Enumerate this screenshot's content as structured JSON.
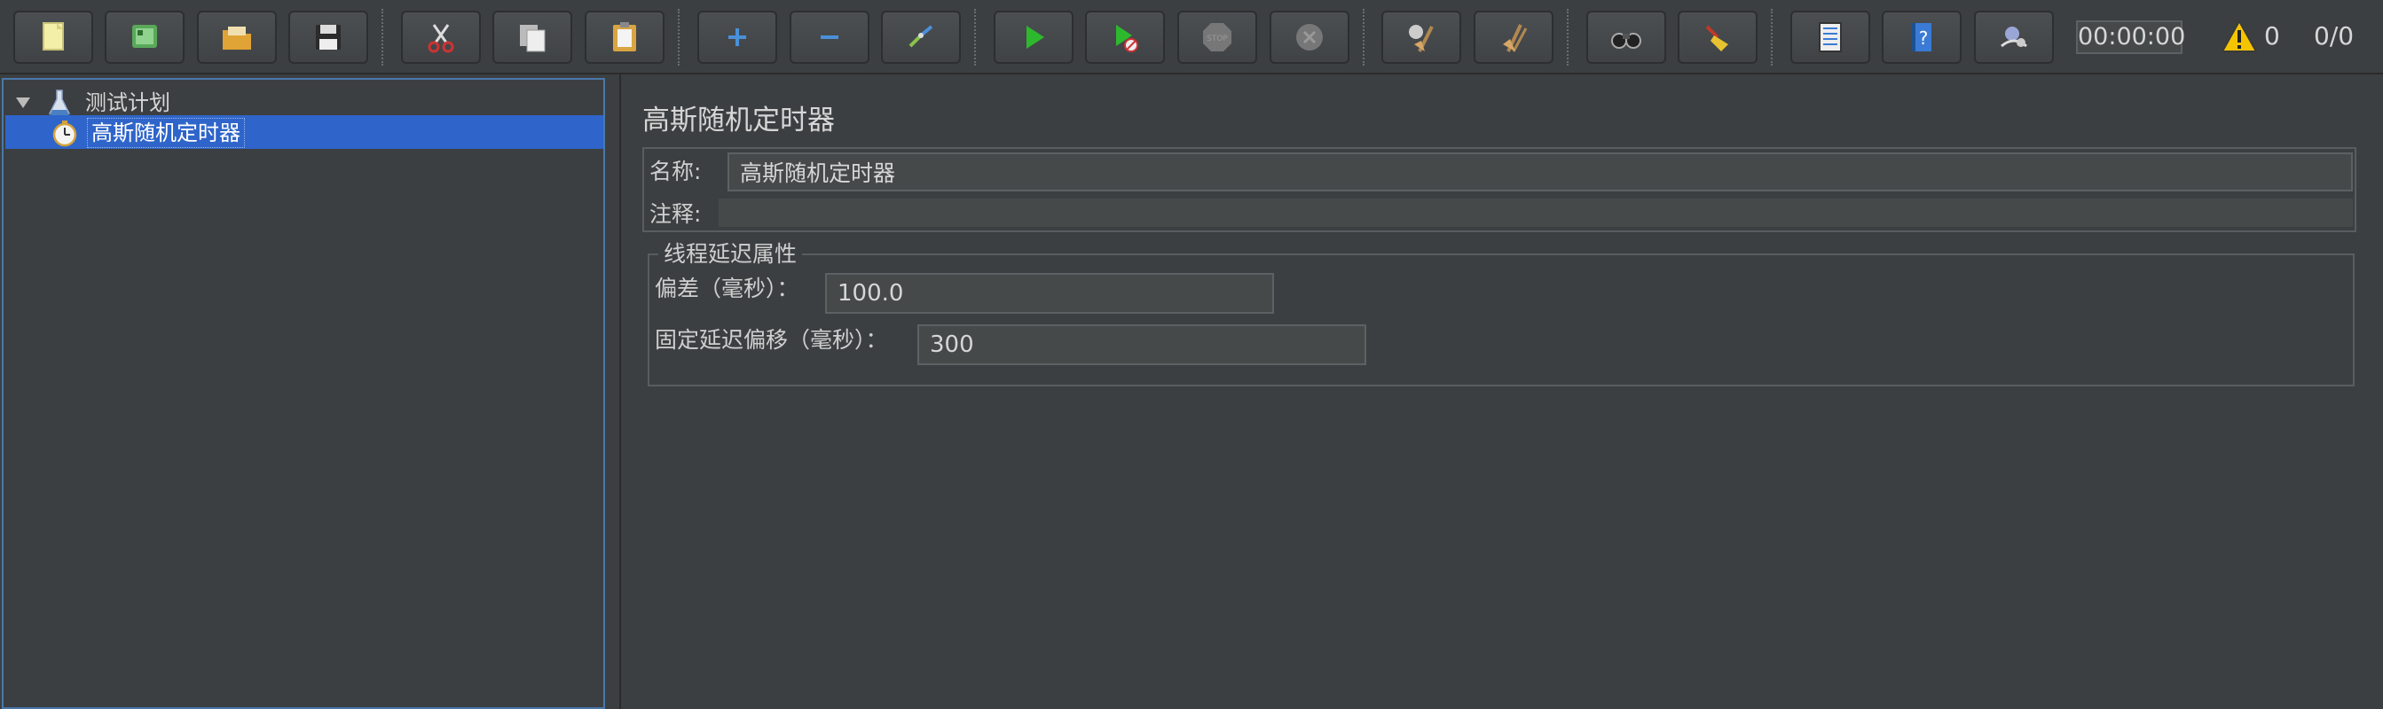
{
  "toolbar": {
    "buttons": [
      {
        "name": "new-icon",
        "color": "#f2eda0"
      },
      {
        "name": "templates-icon",
        "color": "#5aa85a"
      },
      {
        "name": "open-icon",
        "color": "#e0a336"
      },
      {
        "name": "save-icon",
        "color": "#444444"
      },
      {
        "name": "cut-icon",
        "color": "#cc3333"
      },
      {
        "name": "copy-icon",
        "color": "#dddddd"
      },
      {
        "name": "paste-icon",
        "color": "#d9a441"
      },
      {
        "name": "expand-icon",
        "color": "#4a90d9"
      },
      {
        "name": "collapse-icon",
        "color": "#4a90d9"
      },
      {
        "name": "toggle-icon",
        "color": "#8bc34a"
      },
      {
        "name": "start-icon",
        "color": "#2eb82e"
      },
      {
        "name": "start-no-pauses-icon",
        "color": "#2eb82e"
      },
      {
        "name": "stop-icon",
        "color": "#777777"
      },
      {
        "name": "shutdown-icon",
        "color": "#777777"
      },
      {
        "name": "clear-icon",
        "color": "#b08850"
      },
      {
        "name": "clear-all-icon",
        "color": "#b08850"
      },
      {
        "name": "search-icon",
        "color": "#222222"
      },
      {
        "name": "reset-search-icon",
        "color": "#e8c230"
      },
      {
        "name": "function-helper-icon",
        "color": "#cccccc"
      },
      {
        "name": "help-icon",
        "color": "#3a7bd5"
      },
      {
        "name": "remote-icon",
        "color": "#9aa6d6"
      }
    ],
    "timer": "00:00:00",
    "warning_count": "0",
    "thread_count": "0/0",
    "warning_color": "#f5c400"
  },
  "tree": {
    "root": {
      "label": "测试计划",
      "icon": "flask-icon"
    },
    "selected": {
      "label": "高斯随机定时器",
      "icon": "timer-icon"
    },
    "selection_color": "#2f65ca"
  },
  "detail": {
    "title": "高斯随机定时器",
    "name_label": "名称:",
    "name_value": "高斯随机定时器",
    "comment_label": "注释:",
    "comment_value": "",
    "group_title": "线程延迟属性",
    "deviation_label": "偏差（毫秒）：",
    "deviation_value": "100.0",
    "offset_label": "固定延迟偏移（毫秒）：",
    "offset_value": "300"
  }
}
